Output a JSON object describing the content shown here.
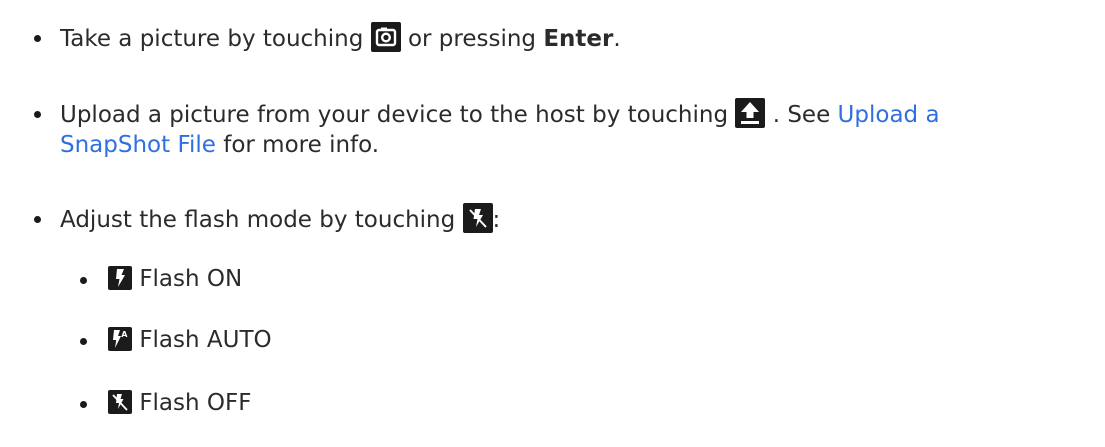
{
  "items": [
    {
      "pre": "Take a picture by touching",
      "icon": "camera-icon",
      "mid": "or pressing",
      "bold": "Enter",
      "post": "."
    },
    {
      "line1_pre": "Upload a picture from your device to the host by touching",
      "icon": "upload-icon",
      "see": ". See",
      "link_line1": "Upload a",
      "link_line2": "SnapShot File",
      "post": "for more info."
    },
    {
      "pre": "Adjust the flash mode by touching",
      "icon": "flash-off-icon",
      "post": ":"
    }
  ],
  "flash_modes": [
    {
      "icon": "flash-on-icon",
      "label": "Flash ON"
    },
    {
      "icon": "flash-auto-icon",
      "label": "Flash AUTO"
    },
    {
      "icon": "flash-off-icon",
      "label": "Flash OFF"
    }
  ]
}
